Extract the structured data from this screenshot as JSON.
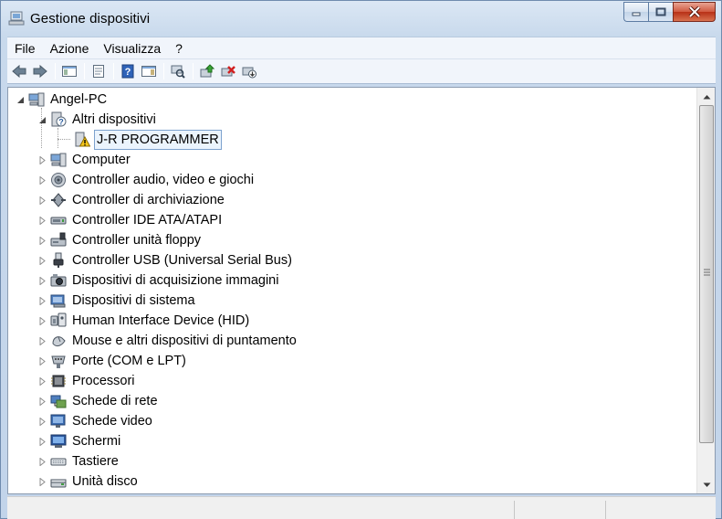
{
  "window": {
    "title": "Gestione dispositivi",
    "colors": {
      "accent": "#3399ff",
      "close": "#c7452d",
      "frame": "#c8d9ec"
    }
  },
  "menu": {
    "items": [
      {
        "label": "File"
      },
      {
        "label": "Azione"
      },
      {
        "label": "Visualizza"
      },
      {
        "label": "?"
      }
    ]
  },
  "toolbar": {
    "buttons": [
      {
        "icon": "back-arrow-icon"
      },
      {
        "icon": "forward-arrow-icon"
      },
      {
        "icon": "show-hide-console-tree-icon"
      },
      {
        "icon": "properties-icon"
      },
      {
        "icon": "help-icon"
      },
      {
        "icon": "action-pane-icon"
      },
      {
        "icon": "scan-hardware-changes-icon"
      },
      {
        "icon": "update-driver-icon"
      },
      {
        "icon": "uninstall-icon"
      },
      {
        "icon": "disable-device-icon"
      }
    ]
  },
  "tree": {
    "root": {
      "label": "Angel-PC",
      "icon": "computer-icon",
      "expanded": true
    },
    "nodes": [
      {
        "label": "Altri dispositivi",
        "icon": "unknown-device-icon",
        "expanded": true,
        "level": 1
      },
      {
        "label": "J-R PROGRAMMER",
        "icon": "warning-device-icon",
        "selected": true,
        "level": 2
      },
      {
        "label": "Computer",
        "icon": "computer-icon",
        "level": 1
      },
      {
        "label": "Controller audio, video e giochi",
        "icon": "speaker-icon",
        "level": 1
      },
      {
        "label": "Controller di archiviazione",
        "icon": "storage-controller-icon",
        "level": 1
      },
      {
        "label": "Controller IDE ATA/ATAPI",
        "icon": "ide-controller-icon",
        "level": 1
      },
      {
        "label": "Controller unità floppy",
        "icon": "floppy-controller-icon",
        "level": 1
      },
      {
        "label": "Controller USB (Universal Serial Bus)",
        "icon": "usb-icon",
        "level": 1
      },
      {
        "label": "Dispositivi di acquisizione immagini",
        "icon": "camera-icon",
        "level": 1
      },
      {
        "label": "Dispositivi di sistema",
        "icon": "system-device-icon",
        "level": 1
      },
      {
        "label": "Human Interface Device (HID)",
        "icon": "hid-icon",
        "level": 1
      },
      {
        "label": "Mouse e altri dispositivi di puntamento",
        "icon": "mouse-icon",
        "level": 1
      },
      {
        "label": "Porte (COM e LPT)",
        "icon": "port-icon",
        "level": 1
      },
      {
        "label": "Processori",
        "icon": "processor-icon",
        "level": 1
      },
      {
        "label": "Schede di rete",
        "icon": "network-adapter-icon",
        "level": 1
      },
      {
        "label": "Schede video",
        "icon": "display-adapter-icon",
        "level": 1
      },
      {
        "label": "Schermi",
        "icon": "monitor-icon",
        "level": 1
      },
      {
        "label": "Tastiere",
        "icon": "keyboard-icon",
        "level": 1
      },
      {
        "label": "Unità disco",
        "icon": "disk-drive-icon",
        "level": 1
      }
    ]
  }
}
